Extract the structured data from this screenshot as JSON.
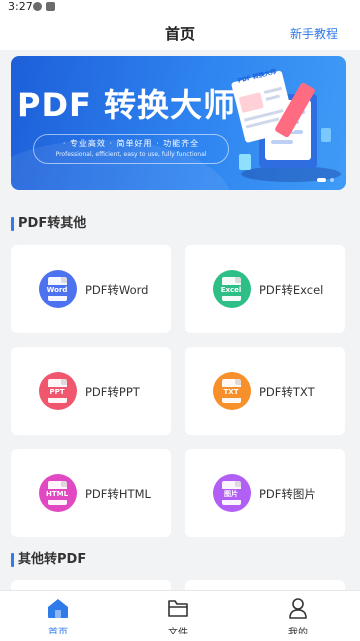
{
  "status_bar": {
    "time": "3:27"
  },
  "header": {
    "title": "首页",
    "tutorial_link": "新手教程"
  },
  "banner": {
    "title": "PDF 转换大师",
    "subtitle": "· 专业高效 · 简单好用 · 功能齐全",
    "subtitle_en": "Professional, efficient, easy to use, fully functional",
    "illustration_text": "PDF 转换大师",
    "active_slide": 1,
    "slide_count": 2,
    "colors": {
      "start": "#1d5fd9",
      "end": "#3f9bf6"
    }
  },
  "sections": [
    {
      "title": "PDF转其他",
      "cards": [
        {
          "label": "PDF转Word",
          "icon": "word-icon",
          "tag": "Word",
          "color": "#4d72f0"
        },
        {
          "label": "PDF转Excel",
          "icon": "excel-icon",
          "tag": "Excel",
          "color": "#2dbf86"
        },
        {
          "label": "PDF转PPT",
          "icon": "ppt-icon",
          "tag": "PPT",
          "color": "#f0566e"
        },
        {
          "label": "PDF转TXT",
          "icon": "txt-icon",
          "tag": "TXT",
          "color": "#f7902b"
        },
        {
          "label": "PDF转HTML",
          "icon": "html-icon",
          "tag": "HTML",
          "color": "#e049c2"
        },
        {
          "label": "PDF转图片",
          "icon": "image-icon",
          "tag": "图片",
          "color": "#b15ff5"
        }
      ]
    },
    {
      "title": "其他转PDF"
    }
  ],
  "bottom_nav": [
    {
      "label": "首页",
      "icon": "home-icon",
      "active": true
    },
    {
      "label": "文件",
      "icon": "folder-icon",
      "active": false
    },
    {
      "label": "我的",
      "icon": "profile-icon",
      "active": false
    }
  ],
  "accent_color": "#2f7bea"
}
